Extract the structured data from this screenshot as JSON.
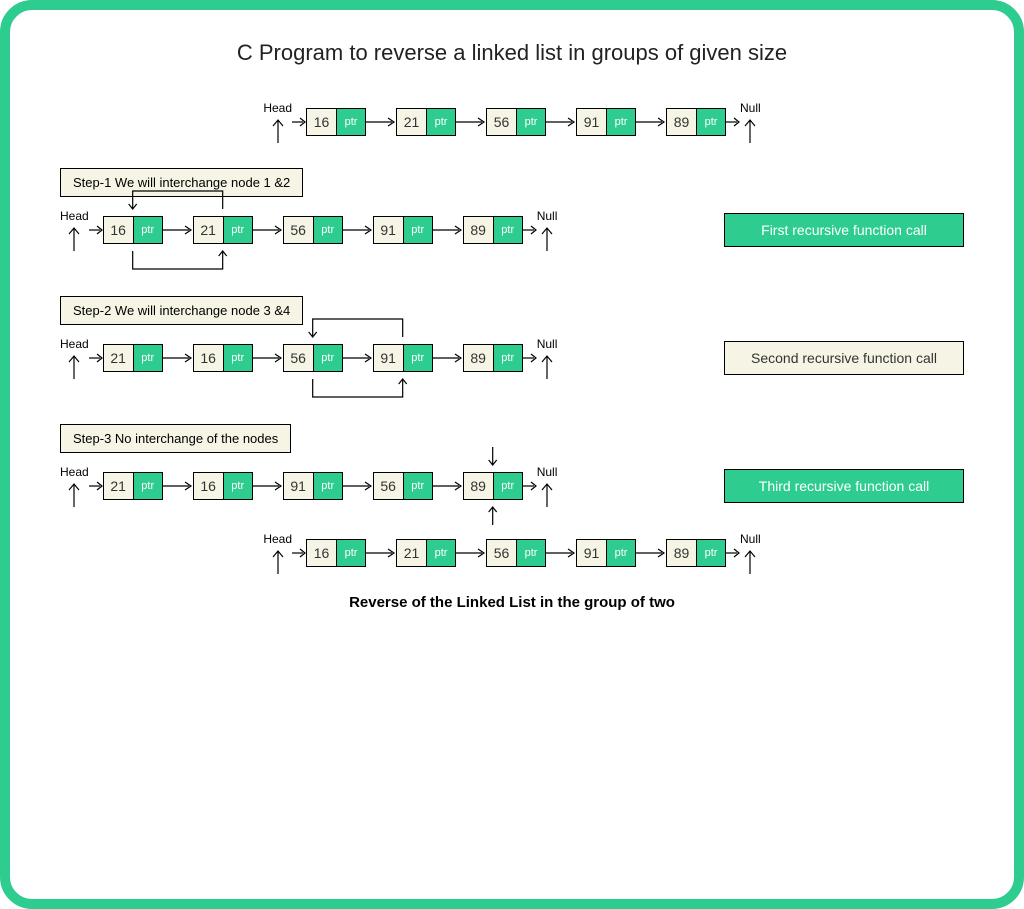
{
  "title": "C Program to reverse a linked list in groups of given size",
  "labels": {
    "head": "Head",
    "null": "Null",
    "ptr": "ptr"
  },
  "initial_list": {
    "nodes": [
      "16",
      "21",
      "56",
      "91",
      "89"
    ]
  },
  "steps": [
    {
      "label": "Step-1  We will interchange node 1 &2",
      "nodes": [
        "16",
        "21",
        "56",
        "91",
        "89"
      ],
      "swap_pair": [
        0,
        1
      ],
      "callout": "First recursive function call",
      "callout_style": "green"
    },
    {
      "label": "Step-2  We will interchange node 3 &4",
      "nodes": [
        "21",
        "16",
        "56",
        "91",
        "89"
      ],
      "swap_pair": [
        2,
        3
      ],
      "callout": "Second recursive function call",
      "callout_style": "cream"
    },
    {
      "label": "Step-3  No interchange of the nodes",
      "nodes": [
        "21",
        "16",
        "91",
        "56",
        "89"
      ],
      "swap_pair": [
        4,
        4
      ],
      "callout": "Third recursive function call",
      "callout_style": "green"
    }
  ],
  "final_list": {
    "nodes": [
      "16",
      "21",
      "56",
      "91",
      "89"
    ]
  },
  "footer": "Reverse of the Linked List in the group of two"
}
